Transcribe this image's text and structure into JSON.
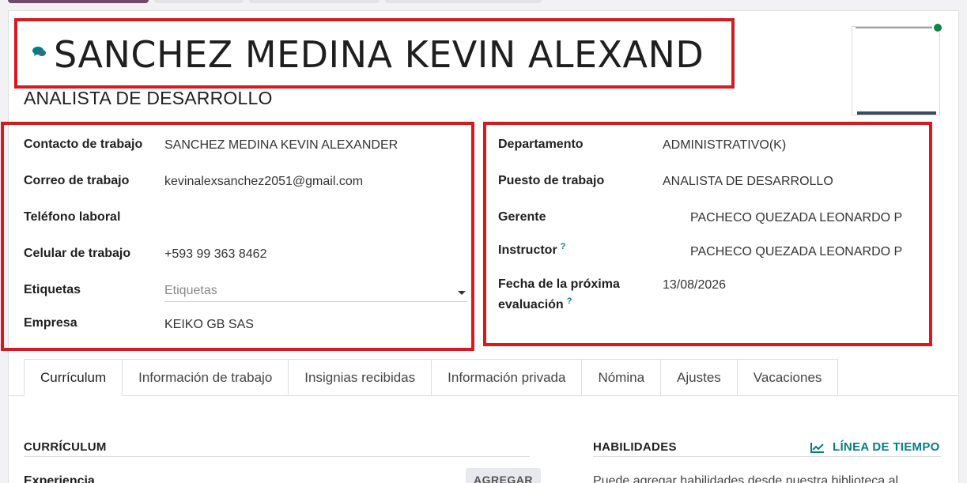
{
  "employee": {
    "name": "SANCHEZ MEDINA KEVIN ALEXAND",
    "job_title": "ANALISTA DE DESARROLLO"
  },
  "left_fields": [
    {
      "label": "Contacto de trabajo",
      "value": "SANCHEZ MEDINA KEVIN ALEXANDER"
    },
    {
      "label": "Correo de trabajo",
      "value": "kevinalexsanchez2051@gmail.com"
    },
    {
      "label": "Teléfono laboral",
      "value": ""
    },
    {
      "label": "Celular de trabajo",
      "value": "+593 99 363 8462"
    },
    {
      "label": "Etiquetas",
      "placeholder": "Etiquetas"
    },
    {
      "label": "Empresa",
      "value": "KEIKO GB SAS"
    }
  ],
  "right_fields": [
    {
      "label": "Departamento",
      "value": "ADMINISTRATIVO(K)"
    },
    {
      "label": "Puesto de trabajo",
      "value": "ANALISTA DE DESARROLLO"
    },
    {
      "label": "Gerente",
      "value": "PACHECO QUEZADA LEONARDO P"
    },
    {
      "label": "Instructor",
      "value": "PACHECO QUEZADA LEONARDO P",
      "help": "?"
    },
    {
      "label_line1": "Fecha de la próxima",
      "label_line2": "evaluación",
      "value": "13/08/2026",
      "help": "?"
    }
  ],
  "tabs": [
    {
      "label": "Currículum",
      "active": true
    },
    {
      "label": "Información de trabajo"
    },
    {
      "label": "Insignias recibidas"
    },
    {
      "label": "Información privada"
    },
    {
      "label": "Nómina"
    },
    {
      "label": "Ajustes"
    },
    {
      "label": "Vacaciones"
    }
  ],
  "resume": {
    "heading": "CURRÍCULUM",
    "experience_label": "Experiencia",
    "add_label": "AGREGAR"
  },
  "skills": {
    "heading": "HABILIDADES",
    "timeline_label": "LÍNEA DE TIEMPO",
    "help_text": "Puede agregar habilidades desde nuestra biblioteca al"
  },
  "colors": {
    "highlight": "#d71920",
    "accent": "#017e84",
    "status": "#11864a",
    "brand": "#714b67"
  },
  "icons": {
    "chat": "chat-bubbles-icon",
    "timeline": "line-chart-icon",
    "dropdown": "caret-down-icon"
  }
}
